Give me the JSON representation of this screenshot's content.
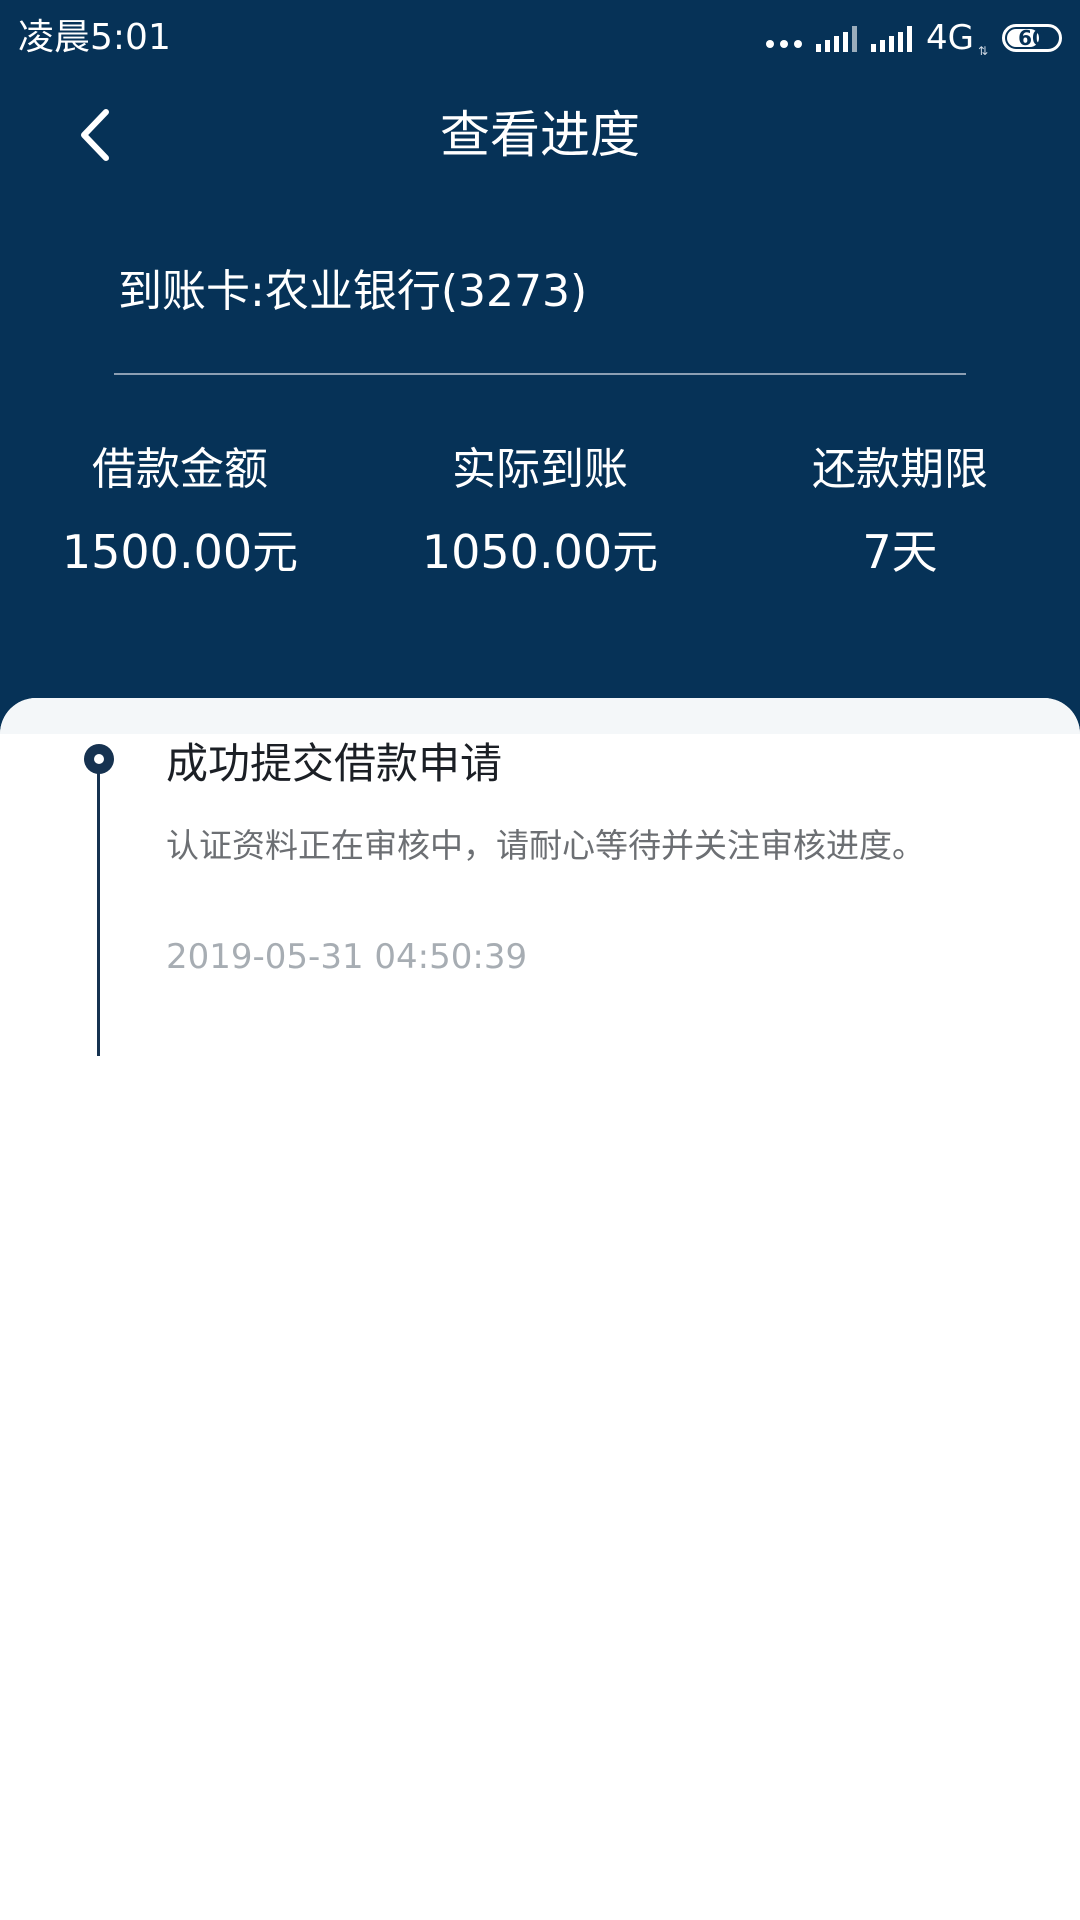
{
  "status_bar": {
    "time": "凌晨5:01",
    "network": "4G",
    "battery": "60",
    "battery_level": 0.6
  },
  "nav": {
    "title": "查看进度",
    "back_icon": "chevron-left-icon"
  },
  "card": {
    "text": "到账卡:农业银行(3273)"
  },
  "stats": [
    {
      "label": "借款金额",
      "value": "1500.00元"
    },
    {
      "label": "实际到账",
      "value": "1050.00元"
    },
    {
      "label": "还款期限",
      "value": "7天"
    }
  ],
  "timeline": [
    {
      "title": "成功提交借款申请",
      "description": "认证资料正在审核中，请耐心等待并关注审核进度。",
      "time": "2019-05-31 04:50:39"
    }
  ],
  "colors": {
    "header_bg": "#063257",
    "timeline": "#163250",
    "panel_strip": "#f4f7f9"
  }
}
